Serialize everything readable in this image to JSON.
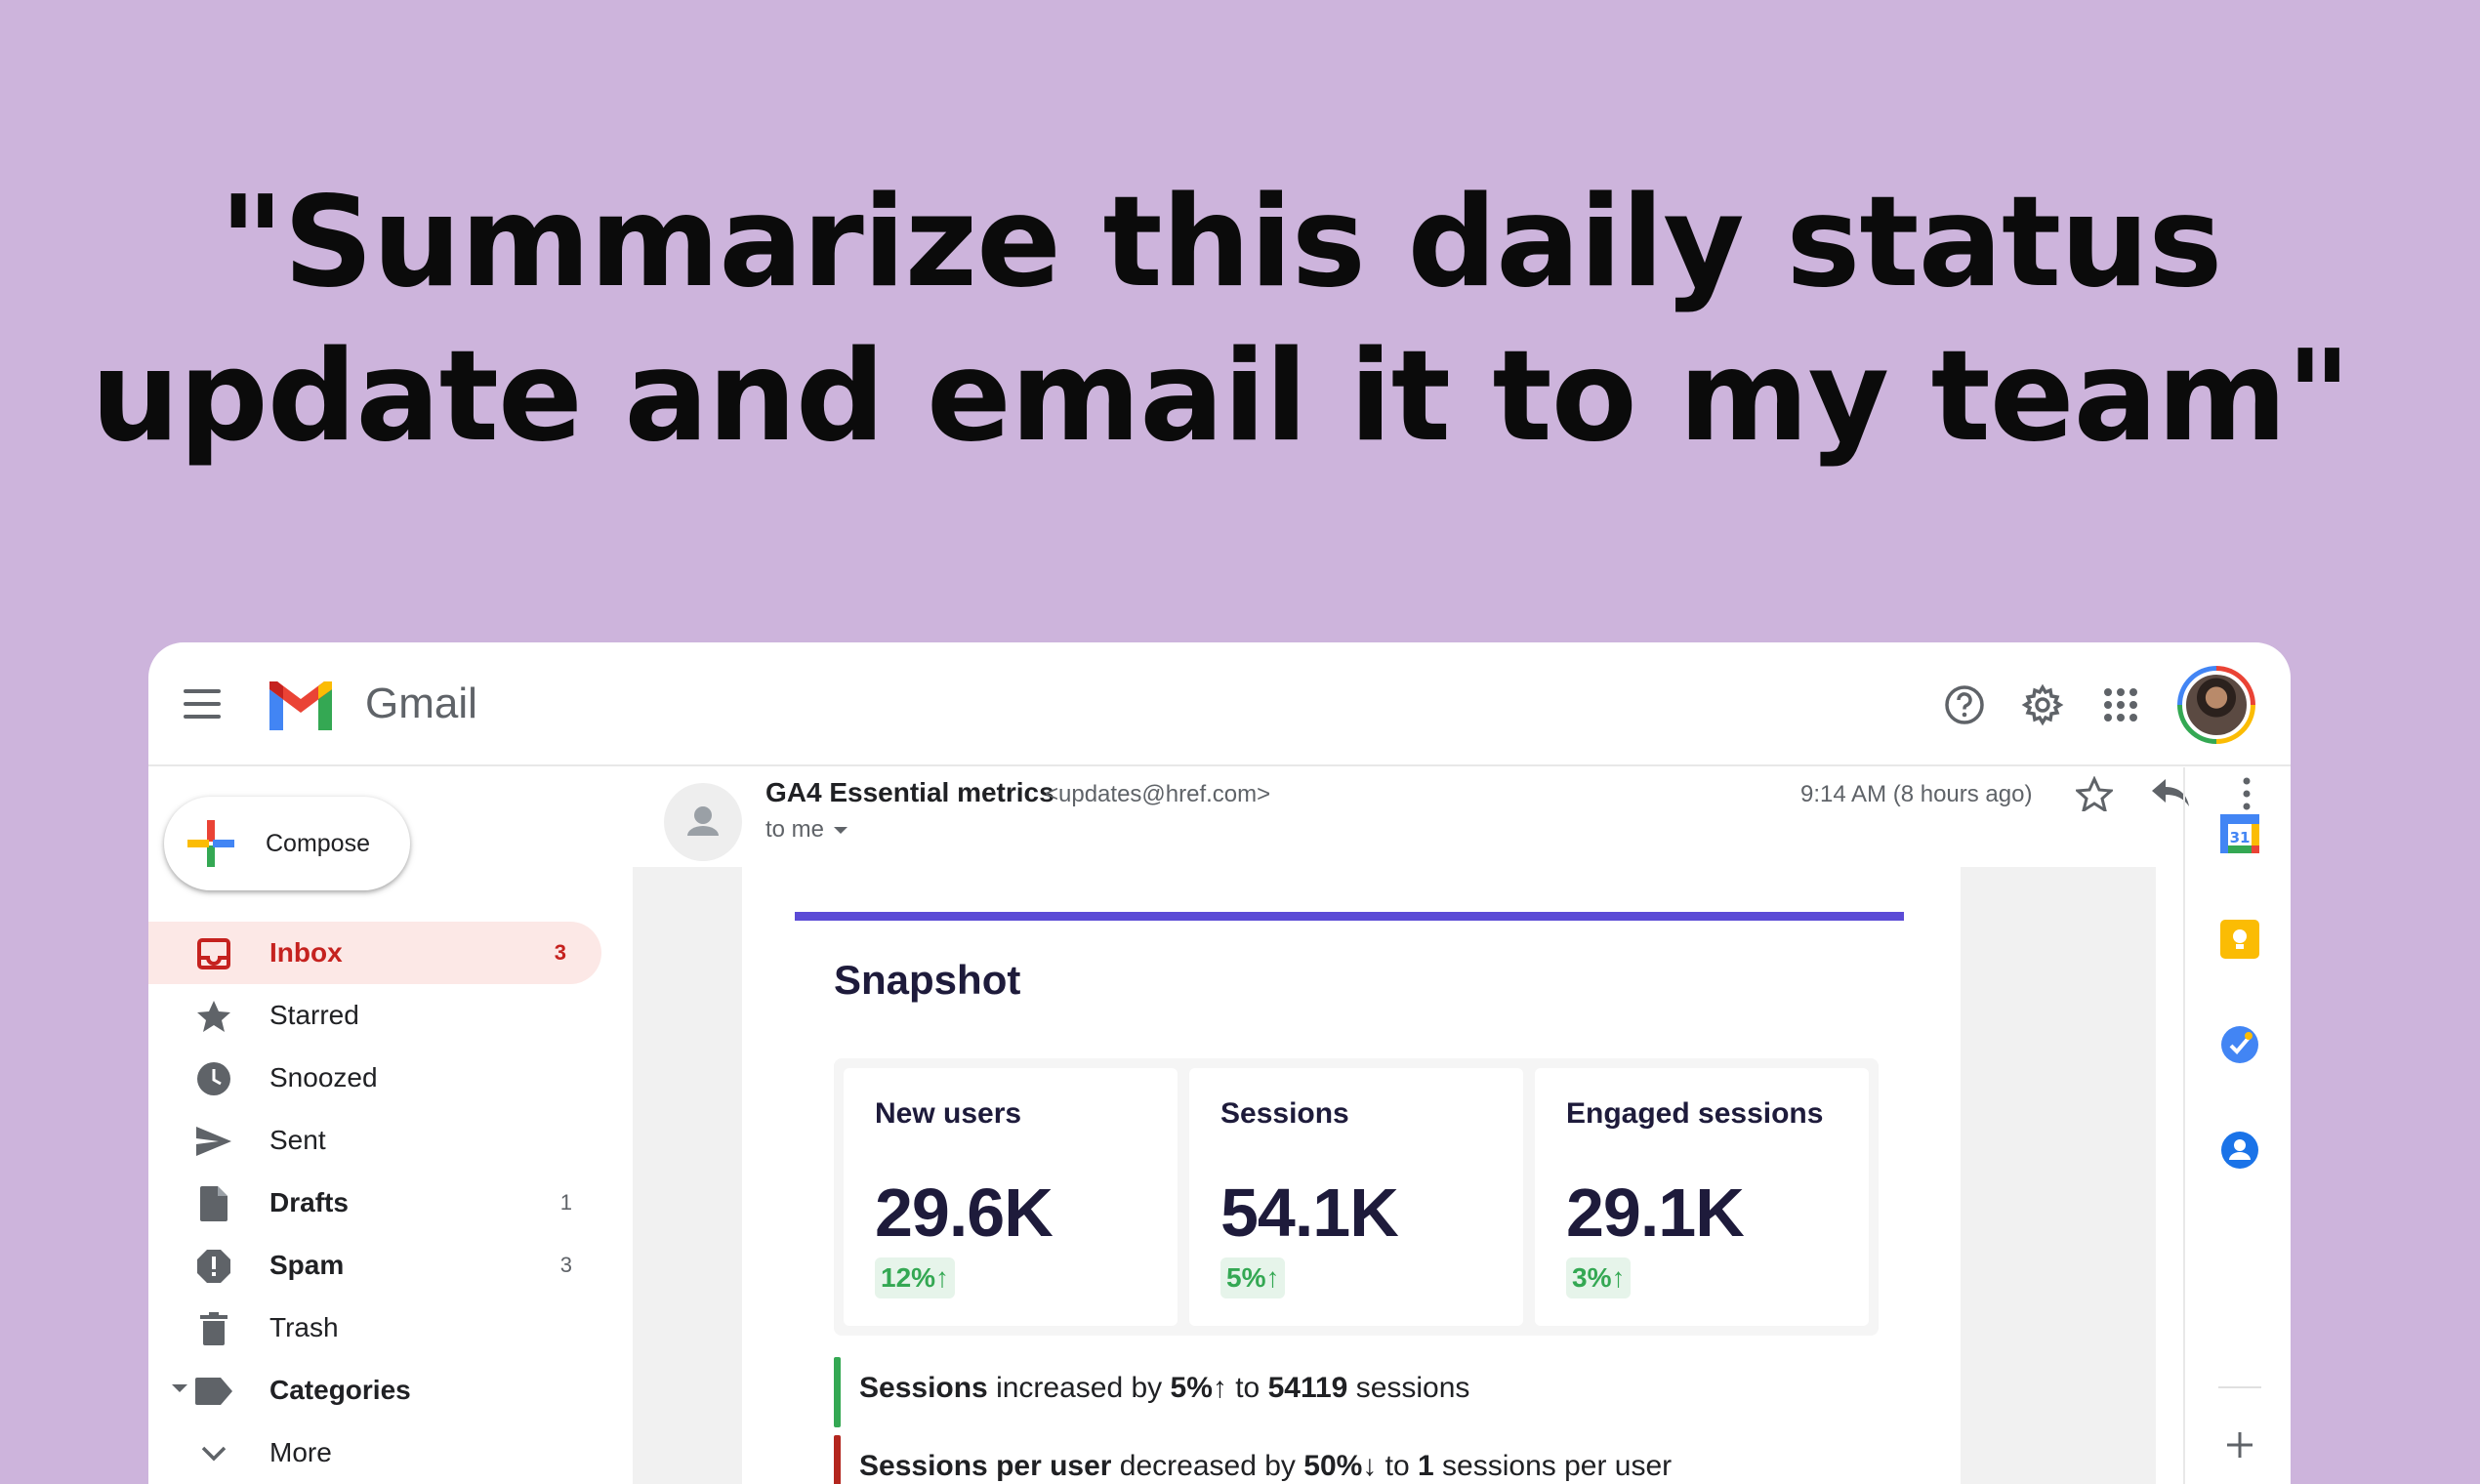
{
  "headline": {
    "line1": "\"Summarize this daily status",
    "line2": "update and email it to my team\""
  },
  "app": {
    "name": "Gmail"
  },
  "topbar": {
    "icons": [
      "menu-icon",
      "help-icon",
      "settings-icon",
      "apps-grid-icon",
      "account-avatar"
    ]
  },
  "sidebar": {
    "compose_label": "Compose",
    "items": [
      {
        "label": "Inbox",
        "count": "3",
        "icon": "inbox-icon",
        "active": true
      },
      {
        "label": "Starred",
        "count": "",
        "icon": "star-icon"
      },
      {
        "label": "Snoozed",
        "count": "",
        "icon": "clock-icon"
      },
      {
        "label": "Sent",
        "count": "",
        "icon": "send-icon"
      },
      {
        "label": "Drafts",
        "count": "1",
        "icon": "draft-icon"
      },
      {
        "label": "Spam",
        "count": "3",
        "icon": "spam-icon"
      },
      {
        "label": "Trash",
        "count": "",
        "icon": "trash-icon"
      },
      {
        "label": "Categories",
        "count": "",
        "icon": "label-icon"
      },
      {
        "label": "More",
        "count": "",
        "icon": "chevron-down-icon"
      }
    ]
  },
  "message": {
    "sender_name": "GA4 Essential metrics",
    "sender_email": "<updates@href.com>",
    "recipient": "to me",
    "time": "9:14 AM (8 hours ago)"
  },
  "email": {
    "section_title": "Snapshot",
    "metrics": [
      {
        "label": "New users",
        "value": "29.6K",
        "change": "12%↑"
      },
      {
        "label": "Sessions",
        "value": "54.1K",
        "change": "5%↑"
      },
      {
        "label": "Engaged sessions",
        "value": "29.1K",
        "change": "3%↑"
      }
    ],
    "insights": [
      {
        "metric": "Sessions",
        "verb": " increased by ",
        "pct": "5%↑",
        "to": " to ",
        "value": "54119",
        "unit": " sessions",
        "color": "#34a853"
      },
      {
        "metric": "Sessions per user",
        "verb": " decreased by ",
        "pct": "50%↓",
        "to": " to ",
        "value": "1",
        "unit": " sessions per user",
        "color": "#b3261e"
      }
    ]
  },
  "right_rail": {
    "icons": [
      "calendar-icon",
      "keep-icon",
      "tasks-icon",
      "contacts-icon",
      "add-icon"
    ]
  },
  "colors": {
    "background": "#cdb4dc",
    "accent": "#5b4bd6",
    "inbox_active": "#c5221f",
    "positive": "#34a853",
    "negative": "#b3261e"
  }
}
